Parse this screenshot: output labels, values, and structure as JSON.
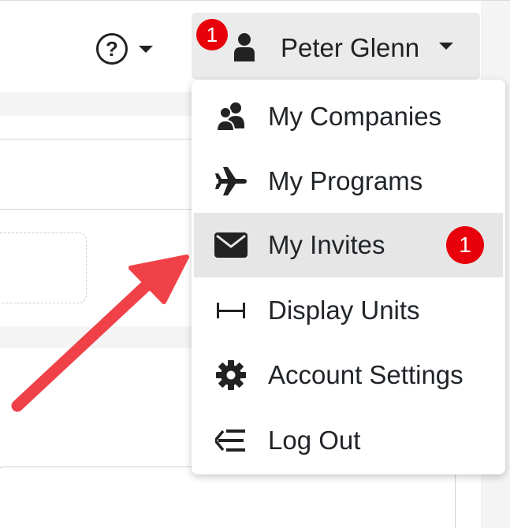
{
  "header": {
    "help": {
      "icon": "question-circle-icon",
      "glyph": "?"
    },
    "user": {
      "badge": "1",
      "icon": "user-icon",
      "name": "Peter Glenn"
    }
  },
  "menu": {
    "items": [
      {
        "label": "My Companies",
        "icon": "users-icon"
      },
      {
        "label": "My Programs",
        "icon": "airplane-icon"
      },
      {
        "label": "My Invites",
        "icon": "envelope-icon",
        "badge": "1",
        "active": true
      },
      {
        "label": "Display Units",
        "icon": "ruler-icon"
      },
      {
        "label": "Account Settings",
        "icon": "gear-icon"
      },
      {
        "label": "Log Out",
        "icon": "logout-icon"
      }
    ]
  },
  "annotation": {
    "arrow_color": "#f04149"
  },
  "colors": {
    "badge": "#e8000b",
    "active_row": "#e6e6e6",
    "user_button": "#ebebeb"
  }
}
